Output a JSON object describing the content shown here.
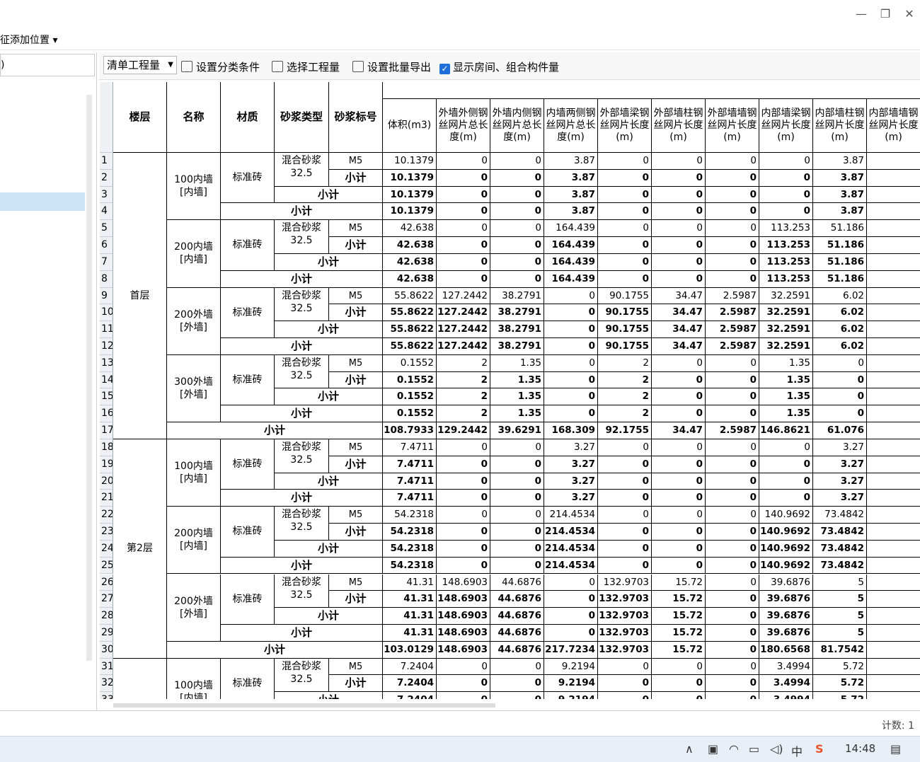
{
  "window": {
    "minimize": "—",
    "restore": "❐",
    "close": "✕"
  },
  "menubar": {
    "label": "征添加位置 ▾"
  },
  "left": {
    "search_text": ")"
  },
  "toolbar": {
    "combo": "清单工程量",
    "set_category": "设置分类条件",
    "select_quantity": "选择工程量",
    "batch_export": "设置批量导出",
    "show_rooms": "显示房间、组合构件量"
  },
  "headers": {
    "floor": "楼层",
    "name": "名称",
    "material": "材质",
    "mortar_type": "砂浆类型",
    "mortar_grade": "砂浆标号",
    "cols": [
      "体积(m3)",
      "外墙外侧钢丝网片总长度(m)",
      "外墙内侧钢丝网片总长度(m)",
      "内墙两侧钢丝网片总长度(m)",
      "外部墙梁钢丝网片长度(m)",
      "外部墙柱钢丝网片长度(m)",
      "外部墙墙钢丝网片长度(m)",
      "内部墙梁钢丝网片长度(m)",
      "内部墙柱钢丝网片长度(m)",
      "内部墙墙钢丝网片长度(m)"
    ]
  },
  "floors": [
    {
      "label": "首层",
      "groups": [
        {
          "name": "100内墙 [内墙]",
          "material": "标准砖",
          "mortar": "混合砂浆 32.5",
          "grade": "M5",
          "detail": [
            "10.1379",
            "0",
            "0",
            "3.87",
            "0",
            "0",
            "0",
            "0",
            "3.87"
          ],
          "total": [
            "10.1379",
            "0",
            "0",
            "3.87",
            "0",
            "0",
            "0",
            "0",
            "3.87"
          ]
        },
        {
          "name": "200内墙 [内墙]",
          "material": "标准砖",
          "mortar": "混合砂浆 32.5",
          "grade": "M5",
          "detail": [
            "42.638",
            "0",
            "0",
            "164.439",
            "0",
            "0",
            "0",
            "113.253",
            "51.186"
          ],
          "total": [
            "42.638",
            "0",
            "0",
            "164.439",
            "0",
            "0",
            "0",
            "113.253",
            "51.186"
          ]
        },
        {
          "name": "200外墙 [外墙]",
          "material": "标准砖",
          "mortar": "混合砂浆 32.5",
          "grade": "M5",
          "detail": [
            "55.8622",
            "127.2442",
            "38.2791",
            "0",
            "90.1755",
            "34.47",
            "2.5987",
            "32.2591",
            "6.02"
          ],
          "total": [
            "55.8622",
            "127.2442",
            "38.2791",
            "0",
            "90.1755",
            "34.47",
            "2.5987",
            "32.2591",
            "6.02"
          ]
        },
        {
          "name": "300外墙 [外墙]",
          "material": "标准砖",
          "mortar": "混合砂浆 32.5",
          "grade": "M5",
          "detail": [
            "0.1552",
            "2",
            "1.35",
            "0",
            "2",
            "0",
            "0",
            "1.35",
            "0"
          ],
          "total": [
            "0.1552",
            "2",
            "1.35",
            "0",
            "2",
            "0",
            "0",
            "1.35",
            "0"
          ]
        }
      ],
      "subtotal": [
        "108.7933",
        "129.2442",
        "39.6291",
        "168.309",
        "92.1755",
        "34.47",
        "2.5987",
        "146.8621",
        "61.076"
      ]
    },
    {
      "label": "第2层",
      "groups": [
        {
          "name": "100内墙 [内墙]",
          "material": "标准砖",
          "mortar": "混合砂浆 32.5",
          "grade": "M5",
          "detail": [
            "7.4711",
            "0",
            "0",
            "3.27",
            "0",
            "0",
            "0",
            "0",
            "3.27"
          ],
          "total": [
            "7.4711",
            "0",
            "0",
            "3.27",
            "0",
            "0",
            "0",
            "0",
            "3.27"
          ]
        },
        {
          "name": "200内墙 [内墙]",
          "material": "标准砖",
          "mortar": "混合砂浆 32.5",
          "grade": "M5",
          "detail": [
            "54.2318",
            "0",
            "0",
            "214.4534",
            "0",
            "0",
            "0",
            "140.9692",
            "73.4842"
          ],
          "total": [
            "54.2318",
            "0",
            "0",
            "214.4534",
            "0",
            "0",
            "0",
            "140.9692",
            "73.4842"
          ]
        },
        {
          "name": "200外墙 [外墙]",
          "material": "标准砖",
          "mortar": "混合砂浆 32.5",
          "grade": "M5",
          "detail": [
            "41.31",
            "148.6903",
            "44.6876",
            "0",
            "132.9703",
            "15.72",
            "0",
            "39.6876",
            "5"
          ],
          "total": [
            "41.31",
            "148.6903",
            "44.6876",
            "0",
            "132.9703",
            "15.72",
            "0",
            "39.6876",
            "5"
          ]
        }
      ],
      "subtotal": [
        "103.0129",
        "148.6903",
        "44.6876",
        "217.7234",
        "132.9703",
        "15.72",
        "0",
        "180.6568",
        "81.7542"
      ]
    },
    {
      "label": "",
      "groups": [
        {
          "name": "100内墙 [内墙]",
          "material": "标准砖",
          "mortar": "混合砂浆 32.5",
          "grade": "M5",
          "detail": [
            "7.2404",
            "0",
            "0",
            "9.2194",
            "0",
            "0",
            "0",
            "3.4994",
            "5.72"
          ],
          "total": [
            "7.2404",
            "0",
            "0",
            "9.2194",
            "0",
            "0",
            "0",
            "3.4994",
            "5.72"
          ]
        }
      ],
      "subtotal": null
    }
  ],
  "subtotal_label": "小计",
  "status": {
    "count": "计数: 1"
  },
  "tray": {
    "time": "14:48",
    "ime": "中",
    "caret": "∧"
  }
}
